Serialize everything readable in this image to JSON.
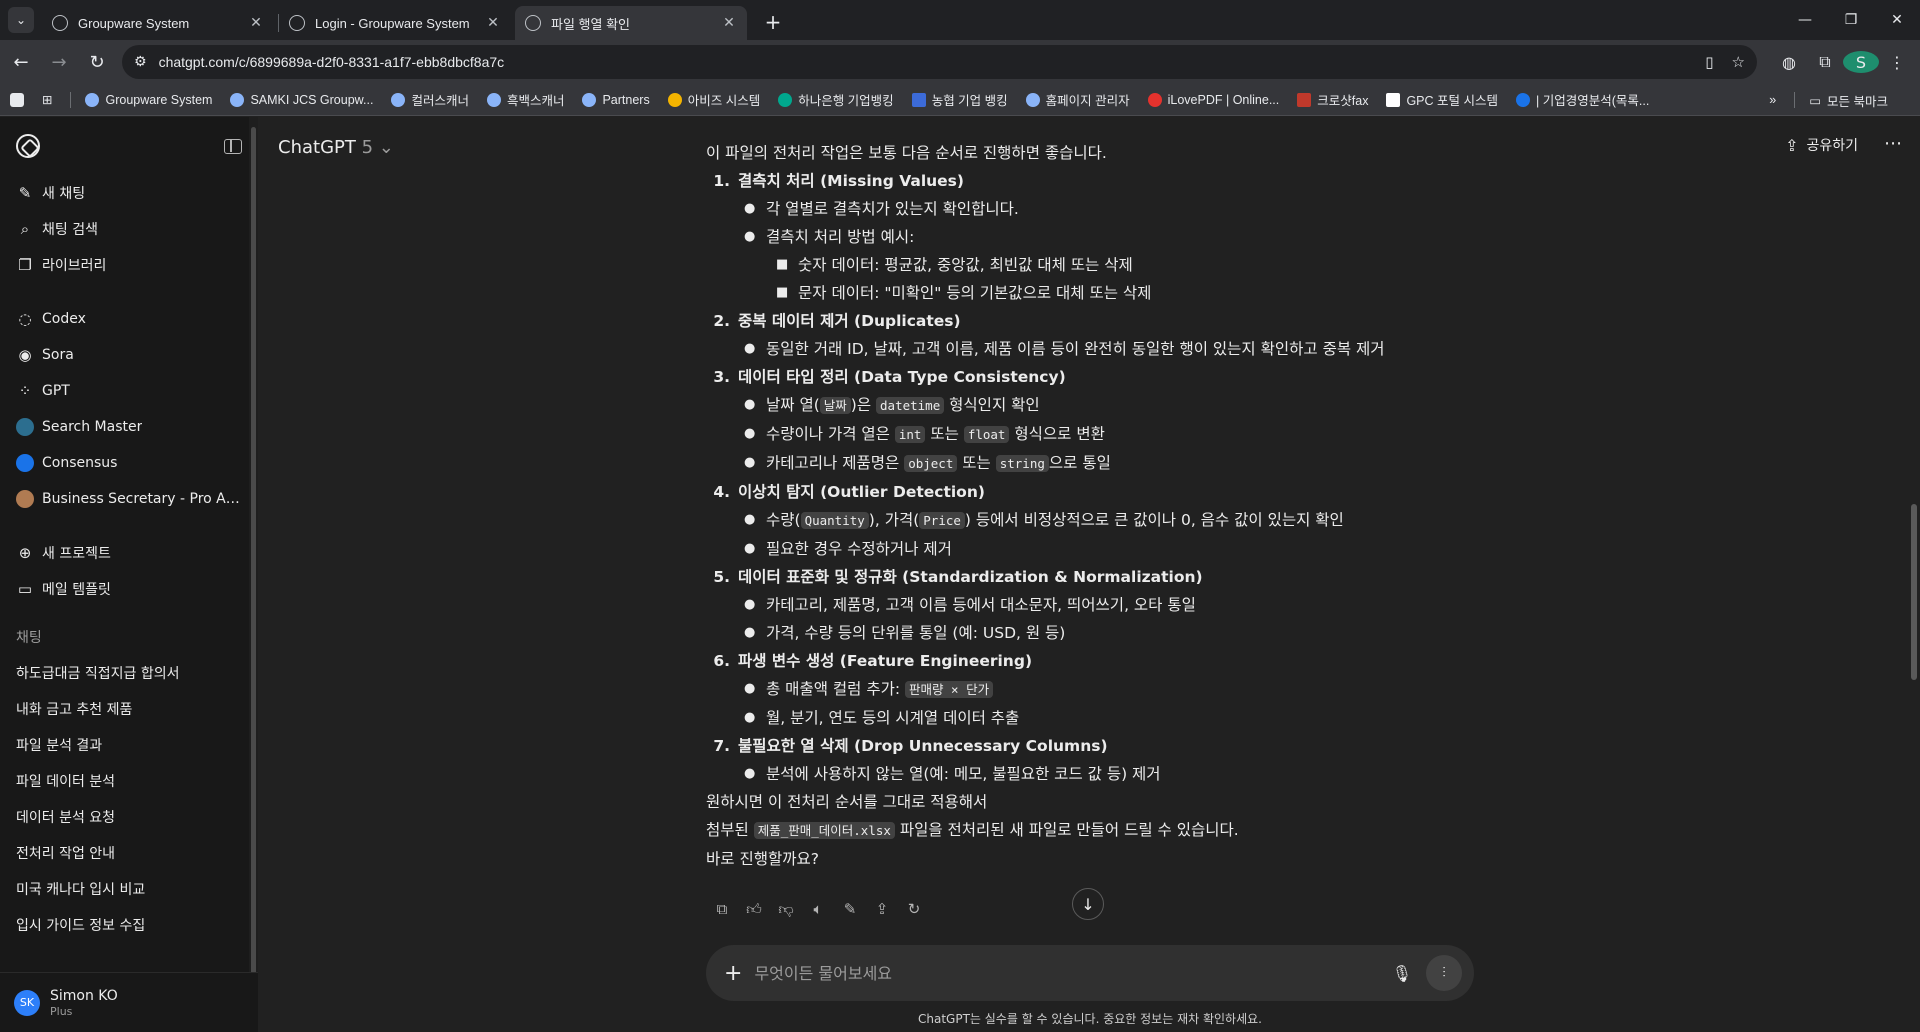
{
  "browser": {
    "tabs": [
      {
        "title": "Groupware System",
        "active": false
      },
      {
        "title": "Login - Groupware System",
        "active": false
      },
      {
        "title": "파일 행열 확인",
        "active": true
      }
    ],
    "url": "chatgpt.com/c/6899689a-d2f0-8331-a1f7-ebb8dbcf8a7c",
    "profile_initial": "S",
    "bookmarks": [
      "Groupware System",
      "SAMKI JCS Groupw...",
      "컬러스캐너",
      "흑백스캐너",
      "Partners",
      "아비즈 시스템",
      "하나은행 기업뱅킹",
      "농협 기업 뱅킹",
      "홈페이지 관리자",
      "iLovePDF | Online...",
      "크로샷fax",
      "GPC 포털 시스템",
      "| 기업경영분석(목록..."
    ],
    "all_bookmarks_label": "모든 북마크"
  },
  "sidebar": {
    "primary": [
      {
        "icon": "new-chat-icon",
        "label": "새 채팅"
      },
      {
        "icon": "search-icon",
        "label": "채팅 검색"
      },
      {
        "icon": "library-icon",
        "label": "라이브러리"
      }
    ],
    "apps": [
      {
        "icon": "codex-icon",
        "label": "Codex"
      },
      {
        "icon": "sora-icon",
        "label": "Sora"
      },
      {
        "icon": "gpt-grid-icon",
        "label": "GPT"
      },
      {
        "icon": "search-master-avatar",
        "label": "Search Master"
      },
      {
        "icon": "consensus-avatar",
        "label": "Consensus"
      },
      {
        "icon": "business-secretary-avatar",
        "label": "Business Secretary - Pro As..."
      }
    ],
    "projects": [
      {
        "icon": "new-project-icon",
        "label": "새 프로젝트"
      },
      {
        "icon": "folder-icon",
        "label": "메일 템플릿"
      }
    ],
    "chats_heading": "채팅",
    "chats": [
      "하도급대금 직접지급 합의서",
      "내화 금고 추천 제품",
      "파일 분석 결과",
      "파일 데이터 분석",
      "데이터 분석 요청",
      "전처리 작업 안내",
      "미국 캐나다 입시 비교",
      "입시 가이드 정보 수집"
    ],
    "user": {
      "initials": "SK",
      "name": "Simon KO",
      "plan": "Plus"
    }
  },
  "main": {
    "model_name": "ChatGPT",
    "model_version": "5",
    "share_label": "공유하기",
    "intro": "이 파일의 전처리 작업은 보통 다음 순서로 진행하면 좋습니다.",
    "sections": [
      {
        "num": "1.",
        "title": "결측치 처리 (Missing Values)"
      },
      {
        "num": "2.",
        "title": "중복 데이터 제거 (Duplicates)"
      },
      {
        "num": "3.",
        "title": "데이터 타입 정리 (Data Type Consistency)"
      },
      {
        "num": "4.",
        "title": "이상치 탐지 (Outlier Detection)"
      },
      {
        "num": "5.",
        "title": "데이터 표준화 및 정규화 (Standardization & Normalization)"
      },
      {
        "num": "6.",
        "title": "파생 변수 생성 (Feature Engineering)"
      },
      {
        "num": "7.",
        "title": "불필요한 열 삭제 (Drop Unnecessary Columns)"
      }
    ],
    "s1": {
      "b1": "각 열별로 결측치가 있는지 확인합니다.",
      "b2": "결측치 처리 방법 예시:",
      "b2a": "숫자 데이터: 평균값, 중앙값, 최빈값 대체 또는 삭제",
      "b2b": "문자 데이터: \"미확인\" 등의 기본값으로 대체 또는 삭제"
    },
    "s2": {
      "b1": "동일한 거래 ID, 날짜, 고객 이름, 제품 이름 등이 완전히 동일한 행이 있는지 확인하고 중복 제거"
    },
    "s3": {
      "b1_pre": "날짜 열(",
      "b1_code1": "날짜",
      "b1_mid": ")은 ",
      "b1_code2": "datetime",
      "b1_post": " 형식인지 확인",
      "b2_pre": "수량이나 가격 열은 ",
      "b2_code1": "int",
      "b2_mid": " 또는 ",
      "b2_code2": "float",
      "b2_post": " 형식으로 변환",
      "b3_pre": "카테고리나 제품명은 ",
      "b3_code1": "object",
      "b3_mid": " 또는 ",
      "b3_code2": "string",
      "b3_post": "으로 통일"
    },
    "s4": {
      "b1_pre": "수량(",
      "b1_code1": "Quantity",
      "b1_mid": "), 가격(",
      "b1_code2": "Price",
      "b1_post": ") 등에서 비정상적으로 큰 값이나 0, 음수 값이 있는지 확인",
      "b2": "필요한 경우 수정하거나 제거"
    },
    "s5": {
      "b1": "카테고리, 제품명, 고객 이름 등에서 대소문자, 띄어쓰기, 오타 통일",
      "b2": "가격, 수량 등의 단위를 통일 (예: USD, 원 등)"
    },
    "s6": {
      "b1_pre": "총 매출액 컬럼 추가: ",
      "b1_code": "판매량 × 단가",
      "b2": "월, 분기, 연도 등의 시계열 데이터 추출"
    },
    "s7": {
      "b1": "분석에 사용하지 않는 열(예: 메모, 불필요한 코드 값 등) 제거"
    },
    "outro1": "원하시면 이 전처리 순서를 그대로 적용해서",
    "outro2_pre": "첨부된 ",
    "outro2_code": "제품_판매_데이터.xlsx",
    "outro2_post": " 파일을 전처리된 새 파일로 만들어 드릴 수 있습니다.",
    "outro3": "바로 진행할까요?",
    "composer_placeholder": "무엇이든 물어보세요",
    "disclaimer": "ChatGPT는 실수를 할 수 있습니다. 중요한 정보는 재차 확인하세요."
  }
}
